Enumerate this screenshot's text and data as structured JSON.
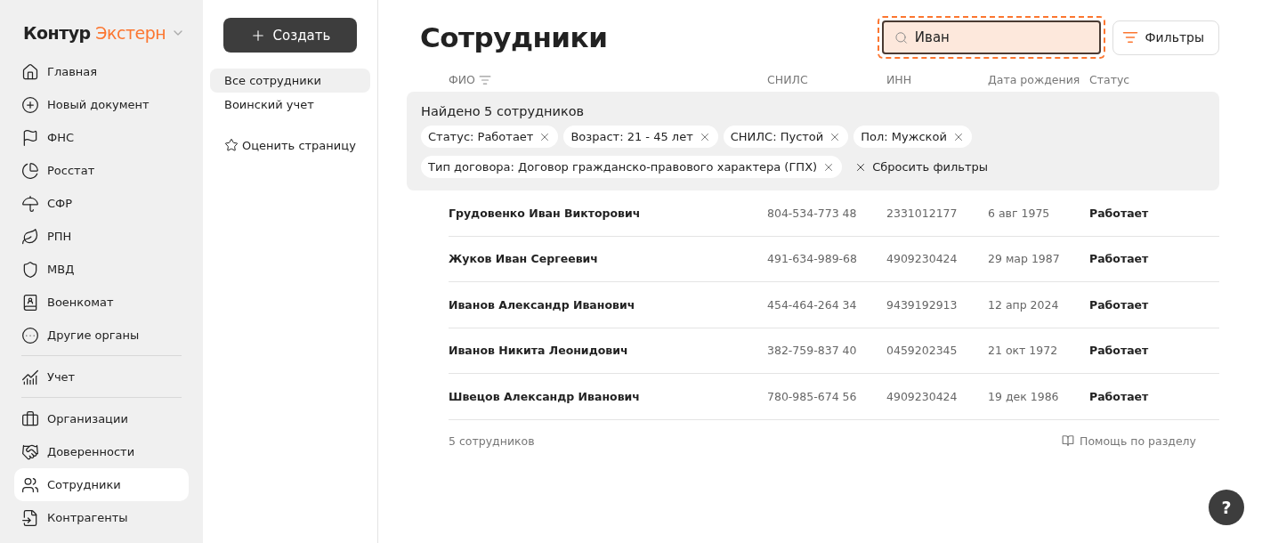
{
  "brand": {
    "name": "Контур",
    "product": "Экстерн"
  },
  "sidebar": {
    "groups": [
      [
        {
          "label": "Главная",
          "selected": false
        },
        {
          "label": "Новый документ",
          "selected": false
        },
        {
          "label": "ФНС",
          "selected": false
        },
        {
          "label": "Росстат",
          "selected": false
        },
        {
          "label": "СФР",
          "selected": false
        },
        {
          "label": "РПН",
          "selected": false
        },
        {
          "label": "МВД",
          "selected": false
        },
        {
          "label": "Военкомат",
          "selected": false
        },
        {
          "label": "Другие органы",
          "selected": false
        }
      ],
      [
        {
          "label": "Учет",
          "selected": false
        }
      ],
      [
        {
          "label": "Организации",
          "selected": false
        },
        {
          "label": "Доверенности",
          "selected": false
        },
        {
          "label": "Сотрудники",
          "selected": true
        },
        {
          "label": "Контрагенты",
          "selected": false
        }
      ]
    ]
  },
  "subnav": {
    "create_button": "Создать",
    "items": [
      {
        "label": "Все сотрудники",
        "selected": true
      },
      {
        "label": "Воинский учет",
        "selected": false
      }
    ],
    "rate_link": "Оценить страницу"
  },
  "page_title": "Сотрудники",
  "search": {
    "value": "Иван",
    "focused": true
  },
  "filters_button": "Фильтры",
  "table": {
    "columns": [
      "ФИО",
      "СНИЛС",
      "ИНН",
      "Дата рождения",
      "Статус"
    ],
    "summary": {
      "title": "Найдено 5 сотрудников",
      "chips": [
        "Статус: Работает",
        "Возраст: 21 - 45 лет",
        "СНИЛС: Пустой",
        "Пол: Мужской",
        "Тип договора: Договор гражданско-правового характера (ГПХ)"
      ],
      "reset": "Сбросить фильтры"
    },
    "rows": [
      [
        "Грудовенко Иван Викторович",
        "804-534-773 48",
        "2331012177",
        "6 авг 1975",
        "Работает"
      ],
      [
        "Жуков Иван Сергеевич",
        "491-634-989-68",
        "4909230424",
        "29 мар 1987",
        "Работает"
      ],
      [
        "Иванов Александр Иванович",
        "454-464-264 34",
        "9439192913",
        "12 апр 2024",
        "Работает"
      ],
      [
        "Иванов Никита Леонидович",
        "382-759-837 40",
        "0459202345",
        "21 окт 1972",
        "Работает"
      ],
      [
        "Швецов Александр Иванович",
        "780-985-674 56",
        "4909230424",
        "19 дек 1986",
        "Работает"
      ]
    ]
  },
  "footer": {
    "count": "5 сотрудников",
    "help_link": "Помощь по разделу"
  },
  "help_button": "?"
}
